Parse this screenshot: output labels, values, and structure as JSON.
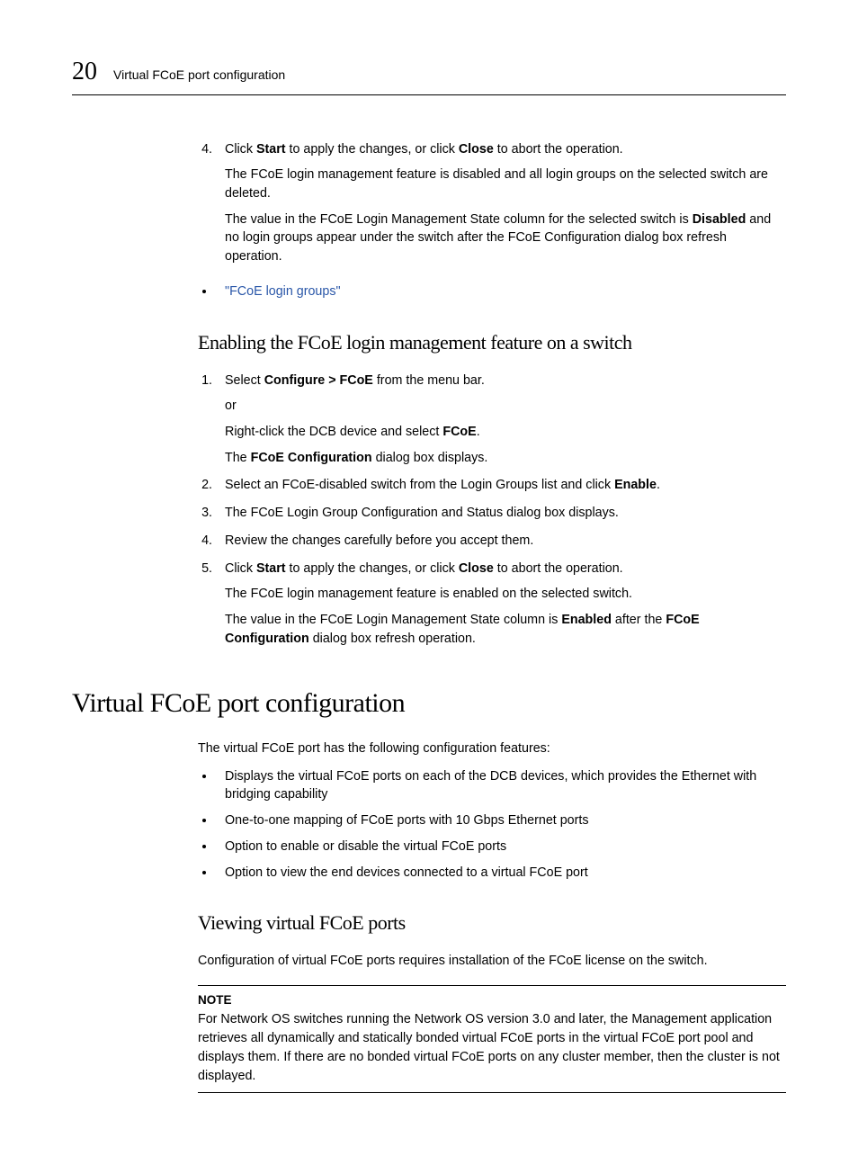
{
  "header": {
    "chapter_number": "20",
    "chapter_title": "Virtual FCoE port configuration"
  },
  "step4": {
    "num": "4.",
    "text_pre": "Click ",
    "start": "Start",
    "text_mid": " to apply the changes, or click ",
    "close": "Close",
    "text_post": " to abort the operation.",
    "p1": "The FCoE login management feature is disabled and all login groups on the selected switch are deleted.",
    "p2_pre": "The value in the FCoE Login Management State column for the selected switch is ",
    "p2_bold": "Disabled",
    "p2_post": " and no login groups appear under the switch after the FCoE Configuration dialog box refresh operation."
  },
  "link_bullet": "\"FCoE login groups\"",
  "sub1": {
    "heading": "Enabling the FCoE login management feature on a switch",
    "s1": {
      "pre": "Select ",
      "bold": "Configure > FCoE",
      "post": " from the menu bar.",
      "or": "or",
      "rc_pre": "Right-click the DCB device and select ",
      "rc_bold": "FCoE",
      "rc_post": ".",
      "dlg_pre": "The ",
      "dlg_bold": "FCoE Configuration",
      "dlg_post": " dialog box displays."
    },
    "s2": {
      "pre": "Select an FCoE-disabled switch from the Login Groups list and click ",
      "bold": "Enable",
      "post": "."
    },
    "s3": "The FCoE Login Group Configuration and Status dialog box displays.",
    "s4": "Review the changes carefully before you accept them.",
    "s5": {
      "pre": "Click ",
      "start": "Start",
      "mid": " to apply the changes, or click ",
      "close": "Close",
      "post": " to abort the operation.",
      "p1": "The FCoE login management feature is enabled on the selected switch.",
      "p2_pre": "The value in the FCoE Login Management State column is ",
      "p2_b1": "Enabled",
      "p2_mid": " after the ",
      "p2_b2": "FCoE Configuration",
      "p2_post": " dialog box refresh operation."
    }
  },
  "section2": {
    "heading": "Virtual FCoE port configuration",
    "intro": "The virtual FCoE port has the following configuration features:",
    "b1": "Displays the virtual FCoE ports on each of the DCB devices, which provides the Ethernet with bridging capability",
    "b2": "One-to-one mapping of FCoE ports with 10 Gbps Ethernet ports",
    "b3": "Option to enable or disable the virtual FCoE ports",
    "b4": "Option to view the end devices connected to a virtual FCoE port"
  },
  "sub2": {
    "heading": "Viewing virtual FCoE ports",
    "p1": "Configuration of virtual FCoE ports requires installation of the FCoE license on the switch.",
    "note_label": "NOTE",
    "note_body": "For Network OS switches running the Network OS version 3.0 and later, the Management application retrieves all dynamically and statically bonded virtual FCoE ports in the virtual FCoE port pool and displays them. If there are no bonded virtual FCoE ports on any cluster member, then the cluster is not displayed."
  }
}
